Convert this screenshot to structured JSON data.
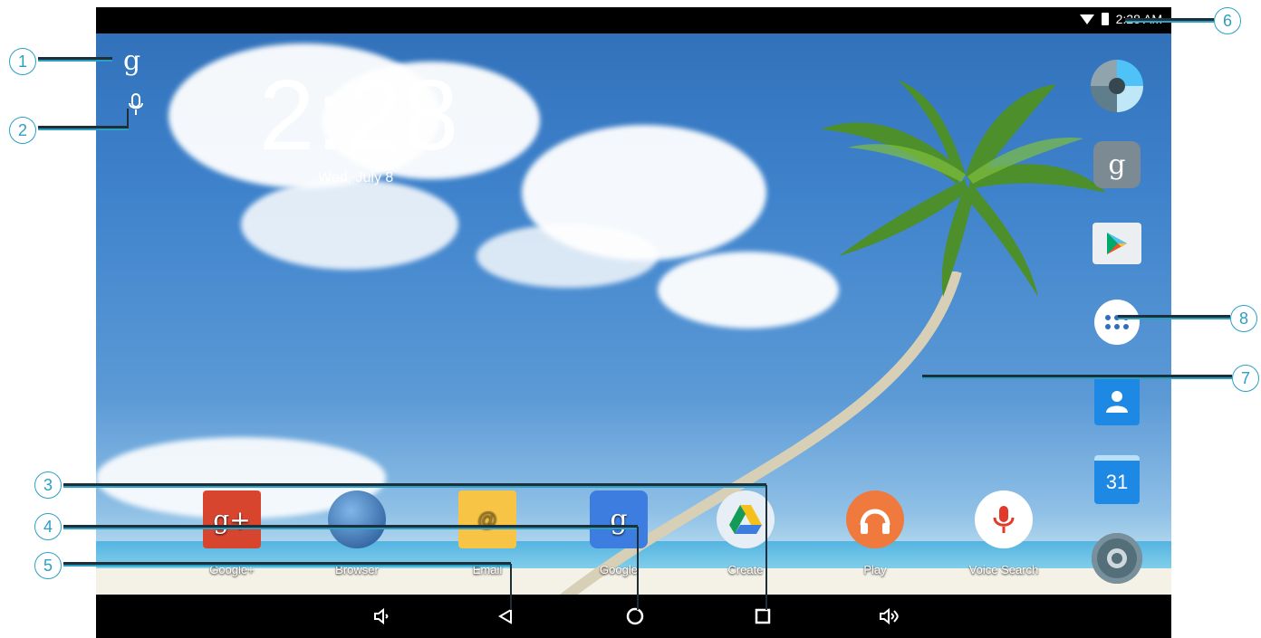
{
  "status": {
    "time": "2:28 AM"
  },
  "lockclock": {
    "time": "2:28",
    "date": "Wed, July 8"
  },
  "dock": [
    {
      "label": "Google+"
    },
    {
      "label": "Browser"
    },
    {
      "label": "Email"
    },
    {
      "label": "Google"
    },
    {
      "label": "Create"
    },
    {
      "label": "Play"
    },
    {
      "label": "Voice Search"
    }
  ],
  "rail": {
    "calendar_day": "31"
  },
  "callouts": [
    "1",
    "2",
    "3",
    "4",
    "5",
    "6",
    "7",
    "8"
  ],
  "icons": {
    "google_search": "google-search-icon",
    "voice": "microphone-icon",
    "back": "back-icon",
    "home": "home-icon",
    "recents": "recents-icon",
    "vol_down": "volume-down-icon",
    "vol_up": "volume-up-icon"
  },
  "colors": {
    "accent": "#2aa0c4"
  }
}
